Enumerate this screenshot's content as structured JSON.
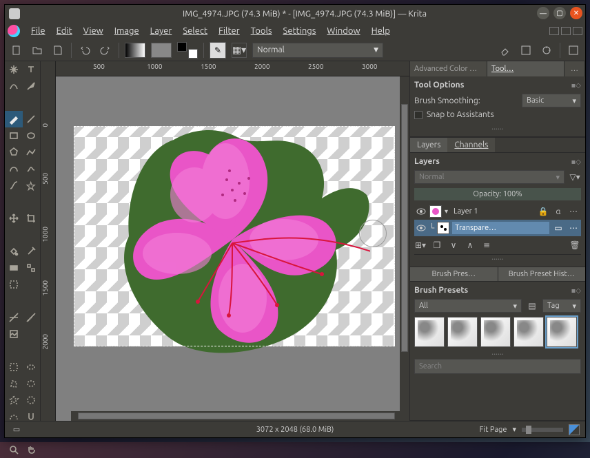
{
  "title": "IMG_4974.JPG (74.3 MiB) * - [IMG_4974.JPG (74.3 MiB)] — Krita",
  "menus": [
    "File",
    "Edit",
    "View",
    "Image",
    "Layer",
    "Select",
    "Filter",
    "Tools",
    "Settings",
    "Window",
    "Help"
  ],
  "toolbar": {
    "blend_mode": "Normal"
  },
  "ruler_h": [
    "500",
    "1000",
    "1500",
    "2000",
    "2500",
    "3000"
  ],
  "ruler_v": [
    "0",
    "500",
    "1000",
    "1500",
    "2000"
  ],
  "dock_tabs": {
    "adv": "Advanced Color …",
    "tool": "Tool…",
    "more": "…"
  },
  "tool_options": {
    "title": "Tool Options",
    "smoothing_label": "Brush Smoothing:",
    "smoothing_value": "Basic",
    "snap_label": "Snap to Assistants"
  },
  "layers_panel": {
    "tab_layers": "Layers",
    "tab_channels": "Channels",
    "title": "Layers",
    "blend": "Normal",
    "opacity": "Opacity:  100%",
    "layer1": "Layer 1",
    "layer2": "Transpare…"
  },
  "preset_tabs": {
    "pres": "Brush Pres…",
    "hist": "Brush Preset Hist…"
  },
  "presets": {
    "title": "Brush Presets",
    "filter": "All",
    "tag": "Tag",
    "search_placeholder": "Search"
  },
  "status": {
    "dims": "3072 x 2048 (68.0 MiB)",
    "fit": "Fit Page"
  }
}
